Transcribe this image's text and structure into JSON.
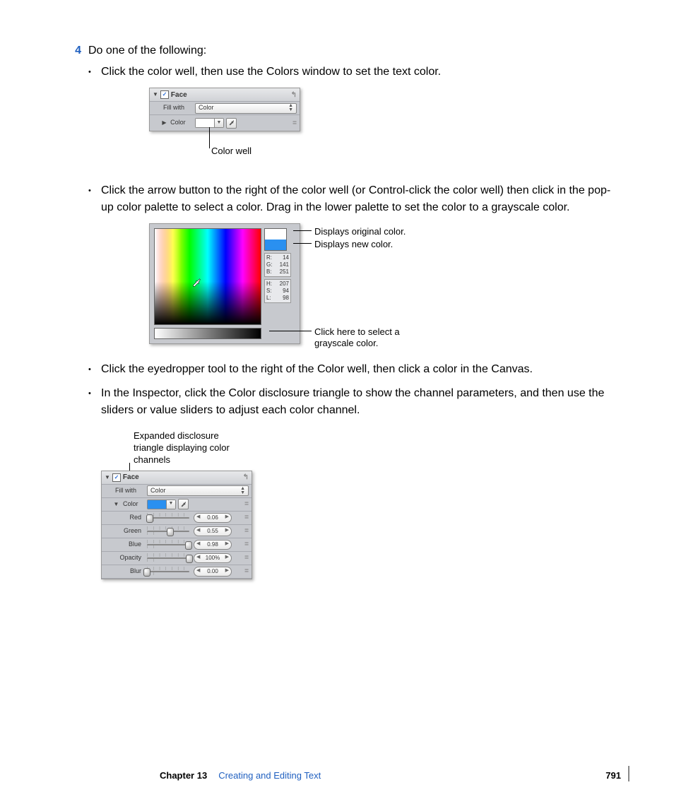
{
  "step": {
    "number": "4",
    "text": "Do one of the following:"
  },
  "bullets": {
    "b1": "Click the color well, then use the Colors window to set the text color.",
    "b2": "Click the arrow button to the right of the color well (or Control-click the color well) then click in the pop-up color palette to select a color. Drag in the lower palette to set the color to a grayscale color.",
    "b3": "Click the eyedropper tool to the right of the Color well, then click a color in the Canvas.",
    "b4": "In the Inspector, click the Color disclosure triangle to show the channel parameters, and then use the sliders or value sliders to adjust each color channel."
  },
  "fig1": {
    "header": "Face",
    "row_fill": "Fill with",
    "combo": "Color",
    "row_color": "Color",
    "callout": "Color well"
  },
  "fig2": {
    "callout_orig": "Displays original color.",
    "callout_new": "Displays new color.",
    "callout_gray1": "Click here to select a",
    "callout_gray2": "grayscale color.",
    "rgb": {
      "r_label": "R:",
      "r": "14",
      "g_label": "G:",
      "g": "141",
      "b_label": "B:",
      "b": "251"
    },
    "hsl": {
      "h_label": "H:",
      "h": "207",
      "s_label": "S:",
      "s": "94",
      "l_label": "L:",
      "l": "98"
    }
  },
  "fig3": {
    "legend1": "Expanded disclosure",
    "legend2": "triangle displaying color",
    "legend3": "channels",
    "header": "Face",
    "row_fill": "Fill with",
    "combo": "Color",
    "row_color": "Color",
    "rows": {
      "red": {
        "label": "Red",
        "value": "0.06",
        "pos": 6
      },
      "green": {
        "label": "Green",
        "value": "0.55",
        "pos": 55
      },
      "blue": {
        "label": "Blue",
        "value": "0.98",
        "pos": 98
      },
      "opacity": {
        "label": "Opacity",
        "value": "100%",
        "pos": 100
      },
      "blur": {
        "label": "Blur",
        "value": "0.00",
        "pos": 0
      }
    }
  },
  "footer": {
    "chapter": "Chapter 13",
    "title": "Creating and Editing Text",
    "page": "791"
  }
}
